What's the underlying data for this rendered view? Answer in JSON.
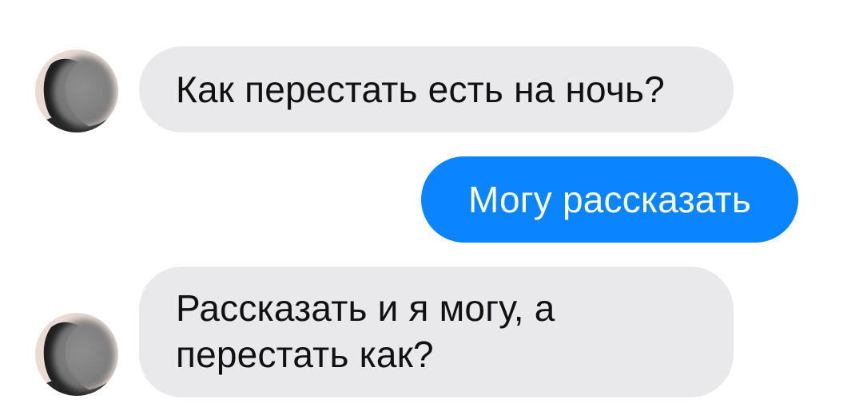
{
  "messages": [
    {
      "id": "msg-1",
      "direction": "incoming",
      "text": "Как перестать есть на ночь?",
      "avatar": "blurred-avatar"
    },
    {
      "id": "msg-2",
      "direction": "outgoing",
      "text": "Могу рассказать"
    },
    {
      "id": "msg-3",
      "direction": "incoming",
      "text": "Рассказать и я могу, а\nперестать как?",
      "avatar": "blurred-avatar"
    }
  ],
  "colors": {
    "incoming_bubble": "#e9e9eb",
    "outgoing_bubble": "#0a84ff",
    "incoming_text": "#111111",
    "outgoing_text": "#ffffff",
    "background": "#ffffff"
  }
}
